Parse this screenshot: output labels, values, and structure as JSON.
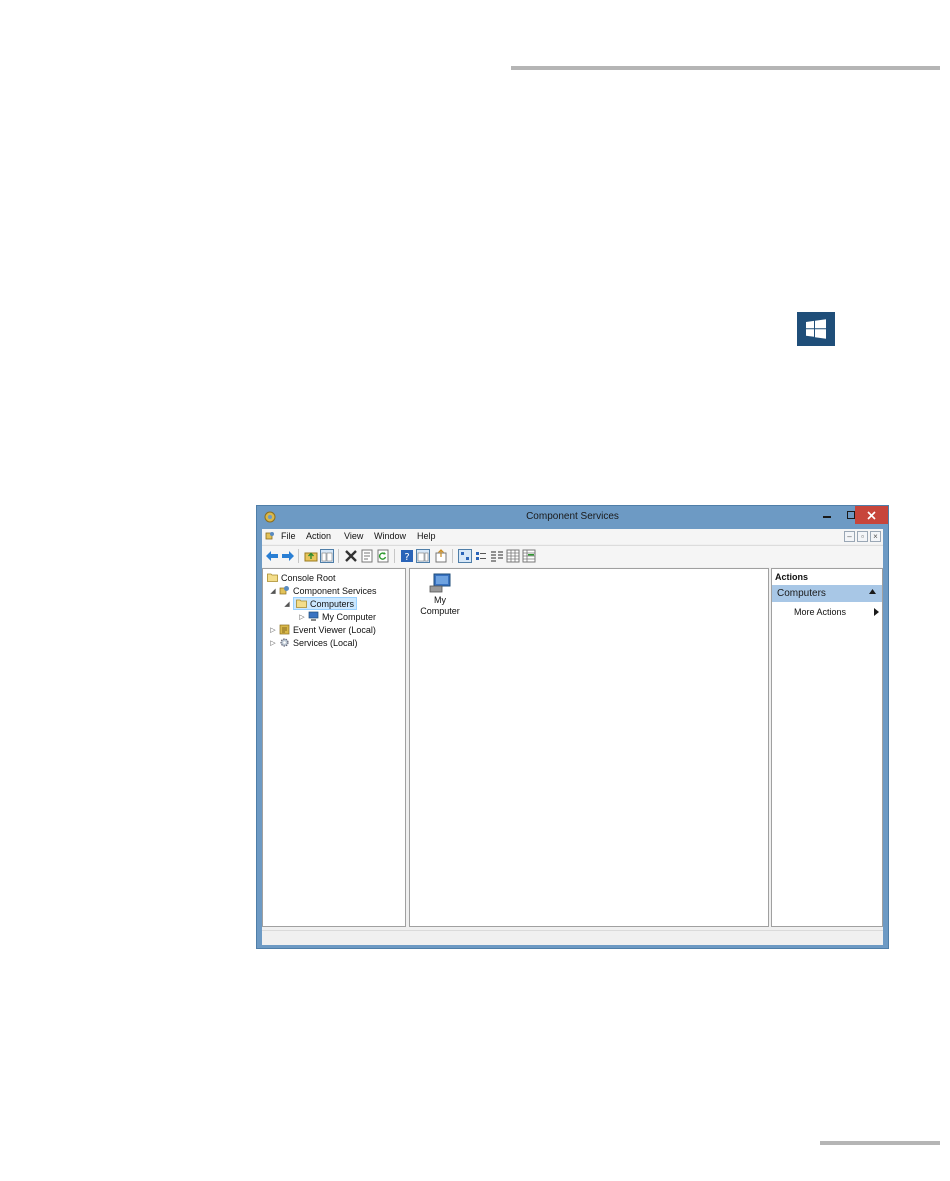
{
  "window": {
    "title": "Component Services"
  },
  "menubar": {
    "items": [
      "File",
      "Action",
      "View",
      "Window",
      "Help"
    ]
  },
  "tree": {
    "root": "Console Root",
    "component_services": "Component Services",
    "computers": "Computers",
    "my_computer": "My Computer",
    "event_viewer": "Event Viewer (Local)",
    "services": "Services (Local)"
  },
  "list": {
    "item_label_line1": "My",
    "item_label_line2": "Computer"
  },
  "actions": {
    "header": "Actions",
    "section_title": "Computers",
    "items": [
      "More Actions"
    ]
  },
  "icons": {
    "windows_key": "windows-logo-icon",
    "back": "back-arrow-icon",
    "forward": "forward-arrow-icon",
    "up": "up-folder-icon",
    "show_hide_tree": "console-tree-icon",
    "delete": "delete-icon",
    "properties": "properties-icon",
    "refresh": "refresh-icon",
    "help": "help-icon",
    "show_hide_action": "action-pane-icon",
    "export": "export-list-icon",
    "large_icons": "large-icons-view-icon",
    "small_icons": "small-icons-view-icon",
    "list_view": "list-view-icon",
    "detail_view": "detail-view-icon",
    "status_view": "status-view-icon"
  },
  "colors": {
    "window_border": "#6d9ac4",
    "close_button": "#c7453b",
    "action_section": "#a8c7e6",
    "selection": "#cce8ff",
    "windows_key": "#1f4e79"
  }
}
